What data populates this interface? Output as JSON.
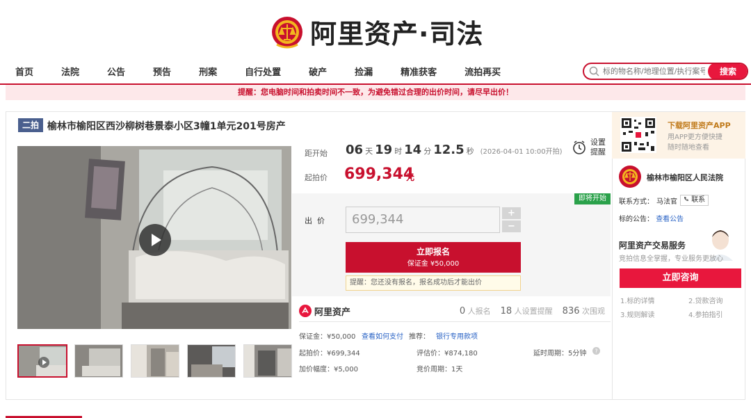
{
  "header": {
    "brand": "阿里资产·司法"
  },
  "nav": {
    "items": [
      "首页",
      "法院",
      "公告",
      "预告",
      "刑案",
      "自行处置",
      "破产",
      "捡漏",
      "精准获客",
      "流拍再买"
    ]
  },
  "search": {
    "placeholder": "标的物名称/地理位置/执行案号",
    "button": "搜索"
  },
  "notice": "提醒：您电脑时间和拍卖时间不一致，为避免错过合理的出价时间，请尽早出价！",
  "item": {
    "round": "二拍",
    "title": "榆林市榆阳区西沙柳树巷景泰小区3幢1单元201号房产"
  },
  "auction": {
    "countdown_label": "距开始",
    "days": "06",
    "days_unit": "天",
    "hours": "19",
    "hours_unit": "时",
    "minutes": "14",
    "minutes_unit": "分",
    "seconds": "12.5",
    "seconds_unit": "秒",
    "start_time": "(2026-04-01 10:00开拍)",
    "start_price_label": "起拍价",
    "start_price": "699,344",
    "currency_unit": "元",
    "remind_label_1": "设置",
    "remind_label_2": "提醒",
    "status_badge": "即将开始",
    "bid_label": "出  价",
    "bid_value": "699,344",
    "plus": "+",
    "minus": "−",
    "signup_title": "立即报名",
    "signup_deposit": "保证金 ¥50,000",
    "hint": "提醒：您还没有报名，报名成功后才能出价"
  },
  "stats": {
    "platform": "阿里资产",
    "signup_count": "0",
    "signup_label": "人报名",
    "remind_count": "18",
    "remind_label": "人设置提醒",
    "view_count": "836",
    "view_label": "次围观"
  },
  "details": {
    "deposit_label": "保证金：¥50,000",
    "deposit_link": "查看如何支付",
    "recommend_label": "推荐：",
    "recommend_link": "银行专用款项",
    "start_price": "起拍价：¥699,344",
    "eval_price": "评估价：¥874,180",
    "delay": "延时周期：5分钟",
    "increment": "加价幅度：¥5,000",
    "bid_cycle": "竞价周期：1天"
  },
  "side": {
    "app_title": "下载阿里资产APP",
    "app_line1": "用APP更方便快捷",
    "app_line2": "随时随地查看",
    "court": "榆林市榆阳区人民法院",
    "contact_label": "联系方式：",
    "contact_name": "马法官",
    "contact_btn": "联系",
    "announce_label": "标的公告：",
    "announce_link": "查看公告",
    "service_title": "阿里资产交易服务",
    "service_sub": "竞拍信息全掌握，专业服务更放心",
    "consult": "立即咨询",
    "guides": [
      "1.标的详情",
      "2.贷款咨询",
      "3.规则解读",
      "4.参拍指引"
    ]
  },
  "colors": {
    "brand_red": "#c8102e",
    "accent_red": "#e8173d",
    "round_badge": "#4a5f8e",
    "status_green": "#2aa14a"
  }
}
